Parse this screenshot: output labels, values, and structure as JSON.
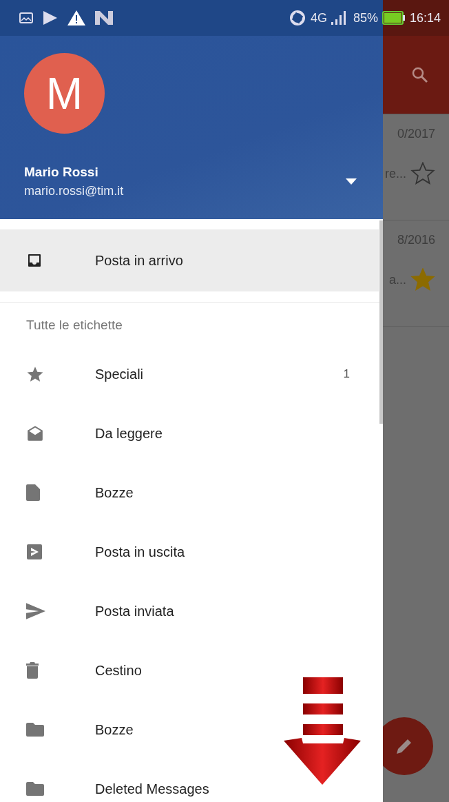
{
  "status_bar": {
    "network": "4G",
    "battery": "85%",
    "time": "16:14"
  },
  "messages": [
    {
      "date": "0/2017",
      "snippet": "re...",
      "starred": false
    },
    {
      "date": "8/2016",
      "snippet": "a...",
      "starred": true
    }
  ],
  "drawer": {
    "account": {
      "initial": "M",
      "name": "Mario Rossi",
      "email": "mario.rossi@tim.it"
    },
    "primary": [
      {
        "label": "Posta in arrivo",
        "kind": "inbox",
        "selected": true
      }
    ],
    "section_title": "Tutte le etichette",
    "labels": [
      {
        "label": "Speciali",
        "kind": "star",
        "count": "1",
        "selected": false
      },
      {
        "label": "Da leggere",
        "kind": "open-envelope",
        "selected": false
      },
      {
        "label": "Bozze",
        "kind": "file",
        "selected": false
      },
      {
        "label": "Posta in uscita",
        "kind": "outbox",
        "selected": false
      },
      {
        "label": "Posta inviata",
        "kind": "send",
        "selected": false
      },
      {
        "label": "Cestino",
        "kind": "trash",
        "selected": false
      },
      {
        "label": "Bozze",
        "kind": "folder",
        "selected": false
      },
      {
        "label": "Deleted Messages",
        "kind": "folder",
        "selected": false
      }
    ]
  }
}
